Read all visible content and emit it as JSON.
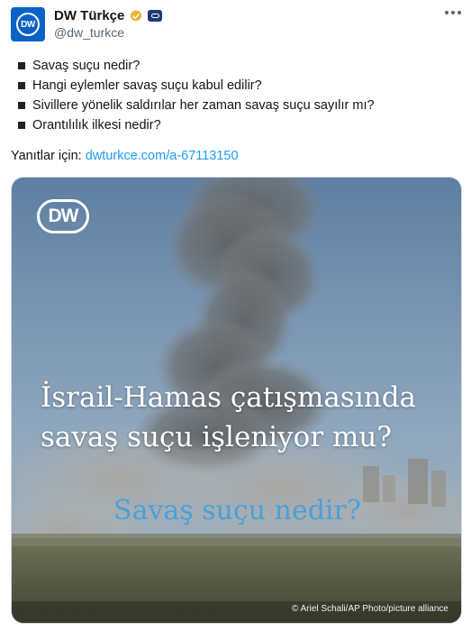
{
  "account": {
    "avatar_text": "DW",
    "display_name": "DW Türkçe",
    "handle": "@dw_turkce"
  },
  "tweet": {
    "bullets": [
      "Savaş suçu nedir?",
      "Hangi eylemler savaş suçu kabul edilir?",
      "Sivillere yönelik saldırılar her zaman savaş suçu sayılır mı?",
      "Orantılılık ilkesi nedir?"
    ],
    "reply_prefix": "Yanıtlar için:",
    "link": "dwturkce.com/a-67113150"
  },
  "media": {
    "logo_text": "DW",
    "headline_line1": "İsrail-Hamas çatışmasında",
    "headline_line2": "savaş suçu işleniyor mu?",
    "subline": "Savaş suçu nedir?",
    "credit": "© Ariel Schali/AP Photo/picture alliance"
  },
  "colors": {
    "brand_blue": "#0a62c6",
    "link": "#1d9bf0",
    "verified_gold": "#e8b23a",
    "subline_blue": "#3a9ee0"
  },
  "icons": [
    "more-options-icon",
    "verified-badge-icon",
    "affiliate-badge-icon"
  ]
}
